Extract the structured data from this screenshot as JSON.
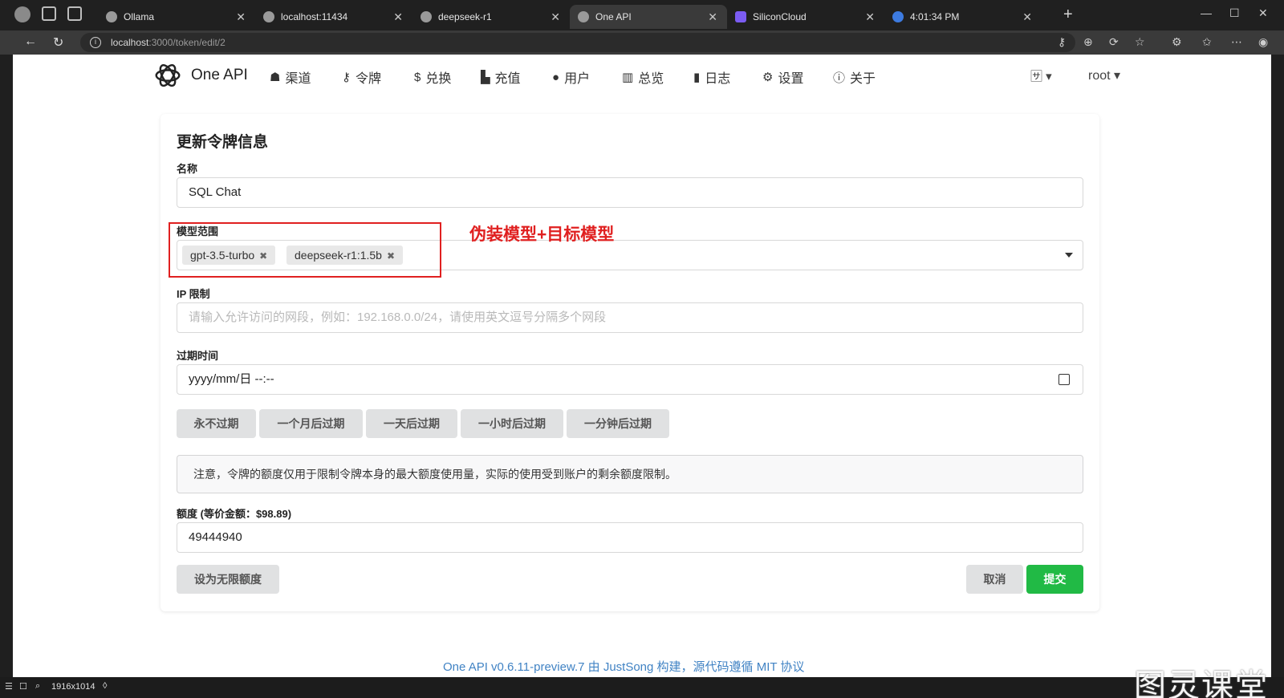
{
  "browser": {
    "tabs": [
      {
        "label": "Ollama",
        "icon": "globe-icon"
      },
      {
        "label": "localhost:11434",
        "icon": "globe-icon"
      },
      {
        "label": "deepseek-r1",
        "icon": "openai-icon"
      },
      {
        "label": "One API",
        "icon": "openai-icon",
        "active": true
      },
      {
        "label": "SiliconCloud",
        "icon": "siliconcloud-icon"
      },
      {
        "label": "4:01:34 PM",
        "icon": "clock-icon"
      }
    ],
    "url_host": "localhost",
    "url_path": ":3000/token/edit/2"
  },
  "nav": {
    "brand": "One API",
    "items": [
      {
        "label": "渠道",
        "icon": "sitemap-icon"
      },
      {
        "label": "令牌",
        "icon": "key-icon"
      },
      {
        "label": "兑换",
        "icon": "dollar-icon"
      },
      {
        "label": "充值",
        "icon": "cart-icon"
      },
      {
        "label": "用户",
        "icon": "user-icon"
      },
      {
        "label": "总览",
        "icon": "bar-chart-icon"
      },
      {
        "label": "日志",
        "icon": "book-icon"
      },
      {
        "label": "设置",
        "icon": "gear-icon"
      },
      {
        "label": "关于",
        "icon": "info-icon"
      }
    ],
    "user": "root"
  },
  "form": {
    "title": "更新令牌信息",
    "name_label": "名称",
    "name_value": "SQL Chat",
    "models_label": "模型范围",
    "models": [
      "gpt-3.5-turbo",
      "deepseek-r1:1.5b"
    ],
    "ip_label": "IP 限制",
    "ip_placeholder": "请输入允许访问的网段，例如：192.168.0.0/24，请使用英文逗号分隔多个网段",
    "expire_label": "过期时间",
    "expire_value": "yyyy/mm/日 --:--",
    "expire_buttons": [
      "永不过期",
      "一个月后过期",
      "一天后过期",
      "一小时后过期",
      "一分钟后过期"
    ],
    "note": "注意，令牌的额度仅用于限制令牌本身的最大额度使用量，实际的使用受到账户的剩余额度限制。",
    "quota_label": "额度 (等价金额：$98.89)",
    "quota_value": "49444940",
    "unlimited_button": "设为无限额度",
    "cancel_button": "取消",
    "submit_button": "提交"
  },
  "annotation": "伪装模型+目标模型",
  "footer": "One API v0.6.11-preview.7 由 JustSong 构建，源代码遵循 MIT 协议",
  "taskbar": {
    "resolution": "1916x1014"
  },
  "watermark": "图灵课堂",
  "colors": {
    "accent": "#21ba45",
    "annotation": "#e02020",
    "link": "#4183c4"
  }
}
